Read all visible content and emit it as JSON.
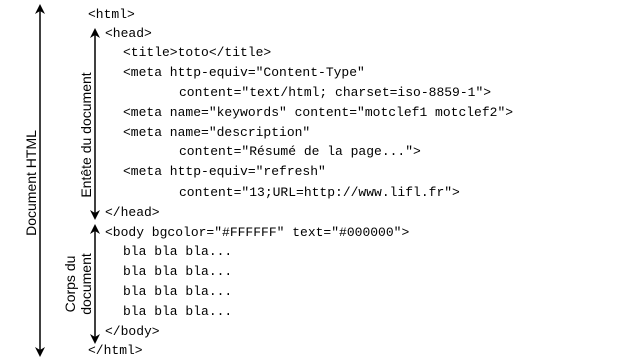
{
  "labels": {
    "document": "Document HTML",
    "head_section": "Entête du document",
    "body_section_line1": "Corps du",
    "body_section_line2": "document"
  },
  "code_lines": [
    "<html>",
    "<head>",
    "<title>toto</title>",
    "<meta http-equiv=\"Content-Type\"",
    "content=\"text/html; charset=iso-8859-1\">",
    "<meta name=\"keywords\" content=\"motclef1 motclef2\">",
    "<meta name=\"description\"",
    "content=\"Résumé de la page...\">",
    "<meta http-equiv=\"refresh\"",
    "content=\"13;URL=http://www.lifl.fr\">",
    "</head>",
    "<body bgcolor=\"#FFFFFF\" text=\"#000000\">",
    "bla bla bla...",
    "bla bla bla...",
    "bla bla bla...",
    "bla bla bla...",
    "</body>",
    "</html>"
  ]
}
